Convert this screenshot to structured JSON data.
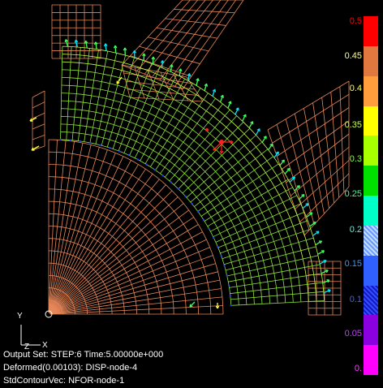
{
  "legend": {
    "labels": [
      "0.5",
      "0.45",
      "0.4",
      "0.35",
      "0.3",
      "0.25",
      "0.2",
      "0.15",
      "0.1",
      "0.05",
      "0."
    ],
    "colors": [
      "#ff0000",
      "#e07840",
      "#ff9d3c",
      "#ffff00",
      "#a8ff00",
      "#00e000",
      "#00ffc8",
      "#9ac6ff",
      "#3060ff",
      "#1818c0",
      "#8a00e0",
      "#ff00ff"
    ]
  },
  "info": {
    "line1": "Output Set: STEP:6 Time:5.00000e+000",
    "line2": "Deformed(0.00103): DISP-node-4",
    "line3": "StdContourVec: NFOR-node-1"
  },
  "axes": {
    "y_label": "Y",
    "x_label": "X",
    "z_label": "Z"
  },
  "colors": {
    "mesh": "#e8885a",
    "contour_main": "#8ee23a",
    "contour_hi": "#c8ff40",
    "vec_green": "#40ff60",
    "vec_cyan": "#00e8ff",
    "vec_yellow": "#ffff40",
    "vec_blue": "#2040ff",
    "vec_red": "#ff2020",
    "origin": "#ffffff"
  }
}
